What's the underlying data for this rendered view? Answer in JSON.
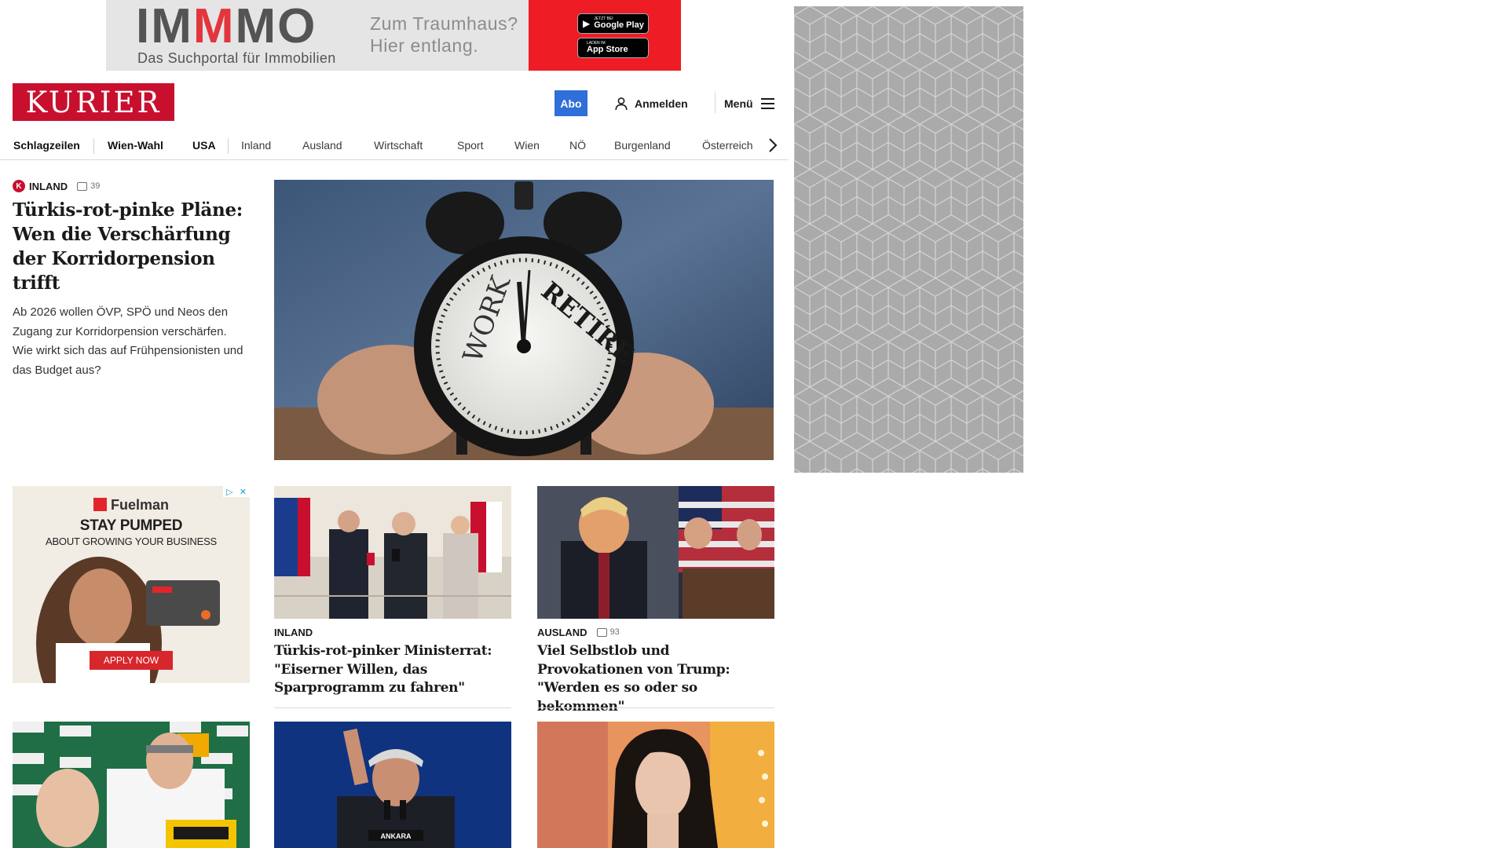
{
  "top_ad": {
    "logo_a": "IM",
    "logo_b": "M",
    "logo_c": "MO",
    "tagline": "Das Suchportal für Immobilien",
    "claim_line1": "Zum Traumhaus?",
    "claim_line2": "Hier entlang.",
    "google_small": "Jetzt bei",
    "google_big": "Google Play",
    "apple_small": "Laden im",
    "apple_big": "App Store"
  },
  "header": {
    "brand": "KURIER",
    "abo": "Abo",
    "login": "Anmelden",
    "menu": "Menü"
  },
  "nav": {
    "items": [
      "Schlagzeilen",
      "Wien-Wahl",
      "USA",
      "Inland",
      "Ausland",
      "Wirtschaft",
      "Sport",
      "Wien",
      "NÖ",
      "Burgenland",
      "Österreich"
    ]
  },
  "lead": {
    "kicker": "Inland",
    "badge": "K",
    "comments": "39",
    "title": "Türkis-rot-pinke Pläne: Wen die Verschärfung der Korridorpension trifft",
    "teaser": "Ab 2026 wollen ÖVP, SPÖ und Neos den Zugang zur Korridorpension verschärfen. Wie wirkt sich das auf Frühpensionisten und das Budget aus?",
    "image_text_left": "WORK",
    "image_text_right": "RETIRE"
  },
  "cards": [
    {
      "kicker": "Inland",
      "comments": "",
      "title": "Türkis-rot-pinker Ministerrat: \"Eiserner Willen, das Sparprogramm zu fahren\""
    },
    {
      "kicker": "Ausland",
      "comments": "93",
      "title": "Viel Selbstlob und Provokationen von Trump: \"Werden es so oder so bekommen\""
    }
  ],
  "fuel_ad": {
    "brand": "Fuelman",
    "headline": "STAY PUMPED",
    "sub": "ABOUT GROWING YOUR BUSINESS",
    "cta": "APPLY NOW"
  },
  "row3": {
    "erdogan_caption": "ANKARA"
  },
  "colors": {
    "brand_red": "#c8102e",
    "abo_blue": "#2f6fd9",
    "immo_red": "#ee1c25"
  }
}
